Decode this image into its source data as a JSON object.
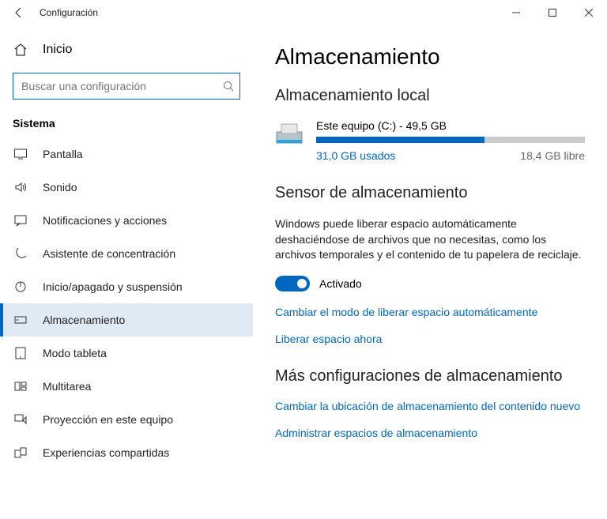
{
  "titlebar": {
    "title": "Configuración"
  },
  "sidebar": {
    "home": "Inicio",
    "search_placeholder": "Buscar una configuración",
    "section": "Sistema",
    "items": [
      {
        "label": "Pantalla"
      },
      {
        "label": "Sonido"
      },
      {
        "label": "Notificaciones y acciones"
      },
      {
        "label": "Asistente de concentración"
      },
      {
        "label": "Inicio/apagado y suspensión"
      },
      {
        "label": "Almacenamiento"
      },
      {
        "label": "Modo tableta"
      },
      {
        "label": "Multitarea"
      },
      {
        "label": "Proyección en este equipo"
      },
      {
        "label": "Experiencias compartidas"
      }
    ]
  },
  "main": {
    "heading": "Almacenamiento",
    "local": {
      "heading": "Almacenamiento local",
      "disk_title": "Este equipo (C:) - 49,5 GB",
      "used": "31,0 GB usados",
      "free": "18,4 GB libre"
    },
    "sensor": {
      "heading": "Sensor de almacenamiento",
      "desc": "Windows puede liberar espacio automáticamente deshaciéndose de archivos que no necesitas, como los archivos temporales y el contenido de tu papelera de reciclaje.",
      "toggle_state": "Activado",
      "link_change": "Cambiar el modo de liberar espacio automáticamente",
      "link_free": "Liberar espacio ahora"
    },
    "more": {
      "heading": "Más configuraciones de almacenamiento",
      "link_location": "Cambiar la ubicación de almacenamiento del contenido nuevo",
      "link_manage": "Administrar espacios de almacenamiento"
    }
  },
  "chart_data": {
    "type": "bar",
    "title": "Este equipo (C:) - 49,5 GB",
    "categories": [
      "Usado",
      "Libre"
    ],
    "values": [
      31.0,
      18.4
    ],
    "unit": "GB",
    "total": 49.5
  }
}
